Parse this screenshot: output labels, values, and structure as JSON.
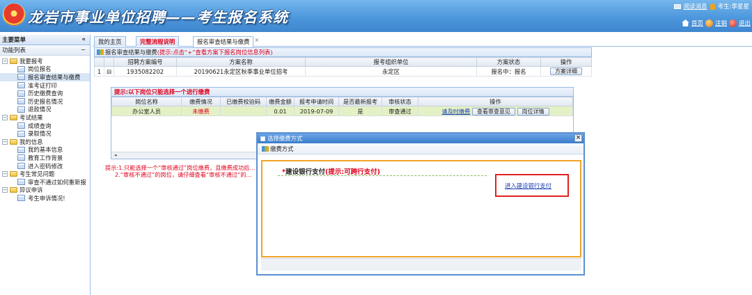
{
  "header": {
    "title": "龙岩市事业单位招聘——考生报名系统",
    "msg_link": "阅读消息",
    "user_label": "考生:李星星",
    "home_link": "首页",
    "logout_link": "注销",
    "exit_link": "退出"
  },
  "left": {
    "title": "主要菜单",
    "collapse": "«",
    "subtitle": "功能列表",
    "sub_toggle": "−",
    "groups": [
      {
        "label": "我要报考",
        "items": [
          "岗位报名",
          "报名审查结果与缴费",
          "准考证打印",
          "历史缴费查询",
          "历史报名情况",
          "退款情况"
        ]
      },
      {
        "label": "考试结果",
        "items": [
          "成绩查询",
          "录取情况"
        ]
      },
      {
        "label": "我的信息",
        "items": [
          "我的基本信息",
          "教育工作背景",
          "进入密码修改"
        ]
      },
      {
        "label": "考生常见问题",
        "items": [
          "审查不通过如何重新报"
        ]
      },
      {
        "label": "异议申诉",
        "items": [
          "考生申诉情况!"
        ]
      }
    ]
  },
  "tabs": {
    "home": "我的主页",
    "flow": "完整流程说明",
    "active": "报名审查结果与缴费",
    "close": "×"
  },
  "panel": {
    "title_prefix": "报名审查结果与缴费",
    "title_hint": "(提示:点击“+”查看方案下报名岗位信息列表)",
    "columns": [
      "招聘方案编号",
      "方案名称",
      "报考组织单位",
      "方案状态",
      "操作"
    ],
    "row": {
      "index": "1",
      "toggle": "⊟",
      "code": "1935082202",
      "name": "20190621永定区秋季事业单位招考",
      "org": "永定区",
      "status": "报名中：报名",
      "action": "方案详细"
    }
  },
  "sub": {
    "title": "提示:以下岗位只能选择一个进行缴费",
    "columns": [
      "岗位名称",
      "缴费情况",
      "已缴费校验码",
      "缴费金额",
      "报考申请时间",
      "是否最新报考",
      "审核状态",
      "操作"
    ],
    "row": {
      "position": "办公室人员",
      "pay_status": "未缴费",
      "code": "",
      "amount": "0.01",
      "date": "2019-07-09",
      "latest": "是",
      "audit": "审查通过",
      "pay_link": "请及时缴费",
      "view_btn": "查看审查意见",
      "detail_btn": "岗位详情"
    },
    "scroll_left": "◂"
  },
  "notes": {
    "line1": "提示:1.只能选择一个“审核通过”岗位缴费，且缴费成功后...",
    "line2": "2.“审核不通过”的岗位，请仔细查看“审核不通过”的..."
  },
  "modal": {
    "title": "选择缴费方式",
    "close": "×",
    "tab_label": "缴费方式",
    "pay_star": "*",
    "pay_title": "建设银行支付",
    "pay_hint": "(提示:可跨行支付)",
    "enter_link": "进入建设银行支付"
  }
}
